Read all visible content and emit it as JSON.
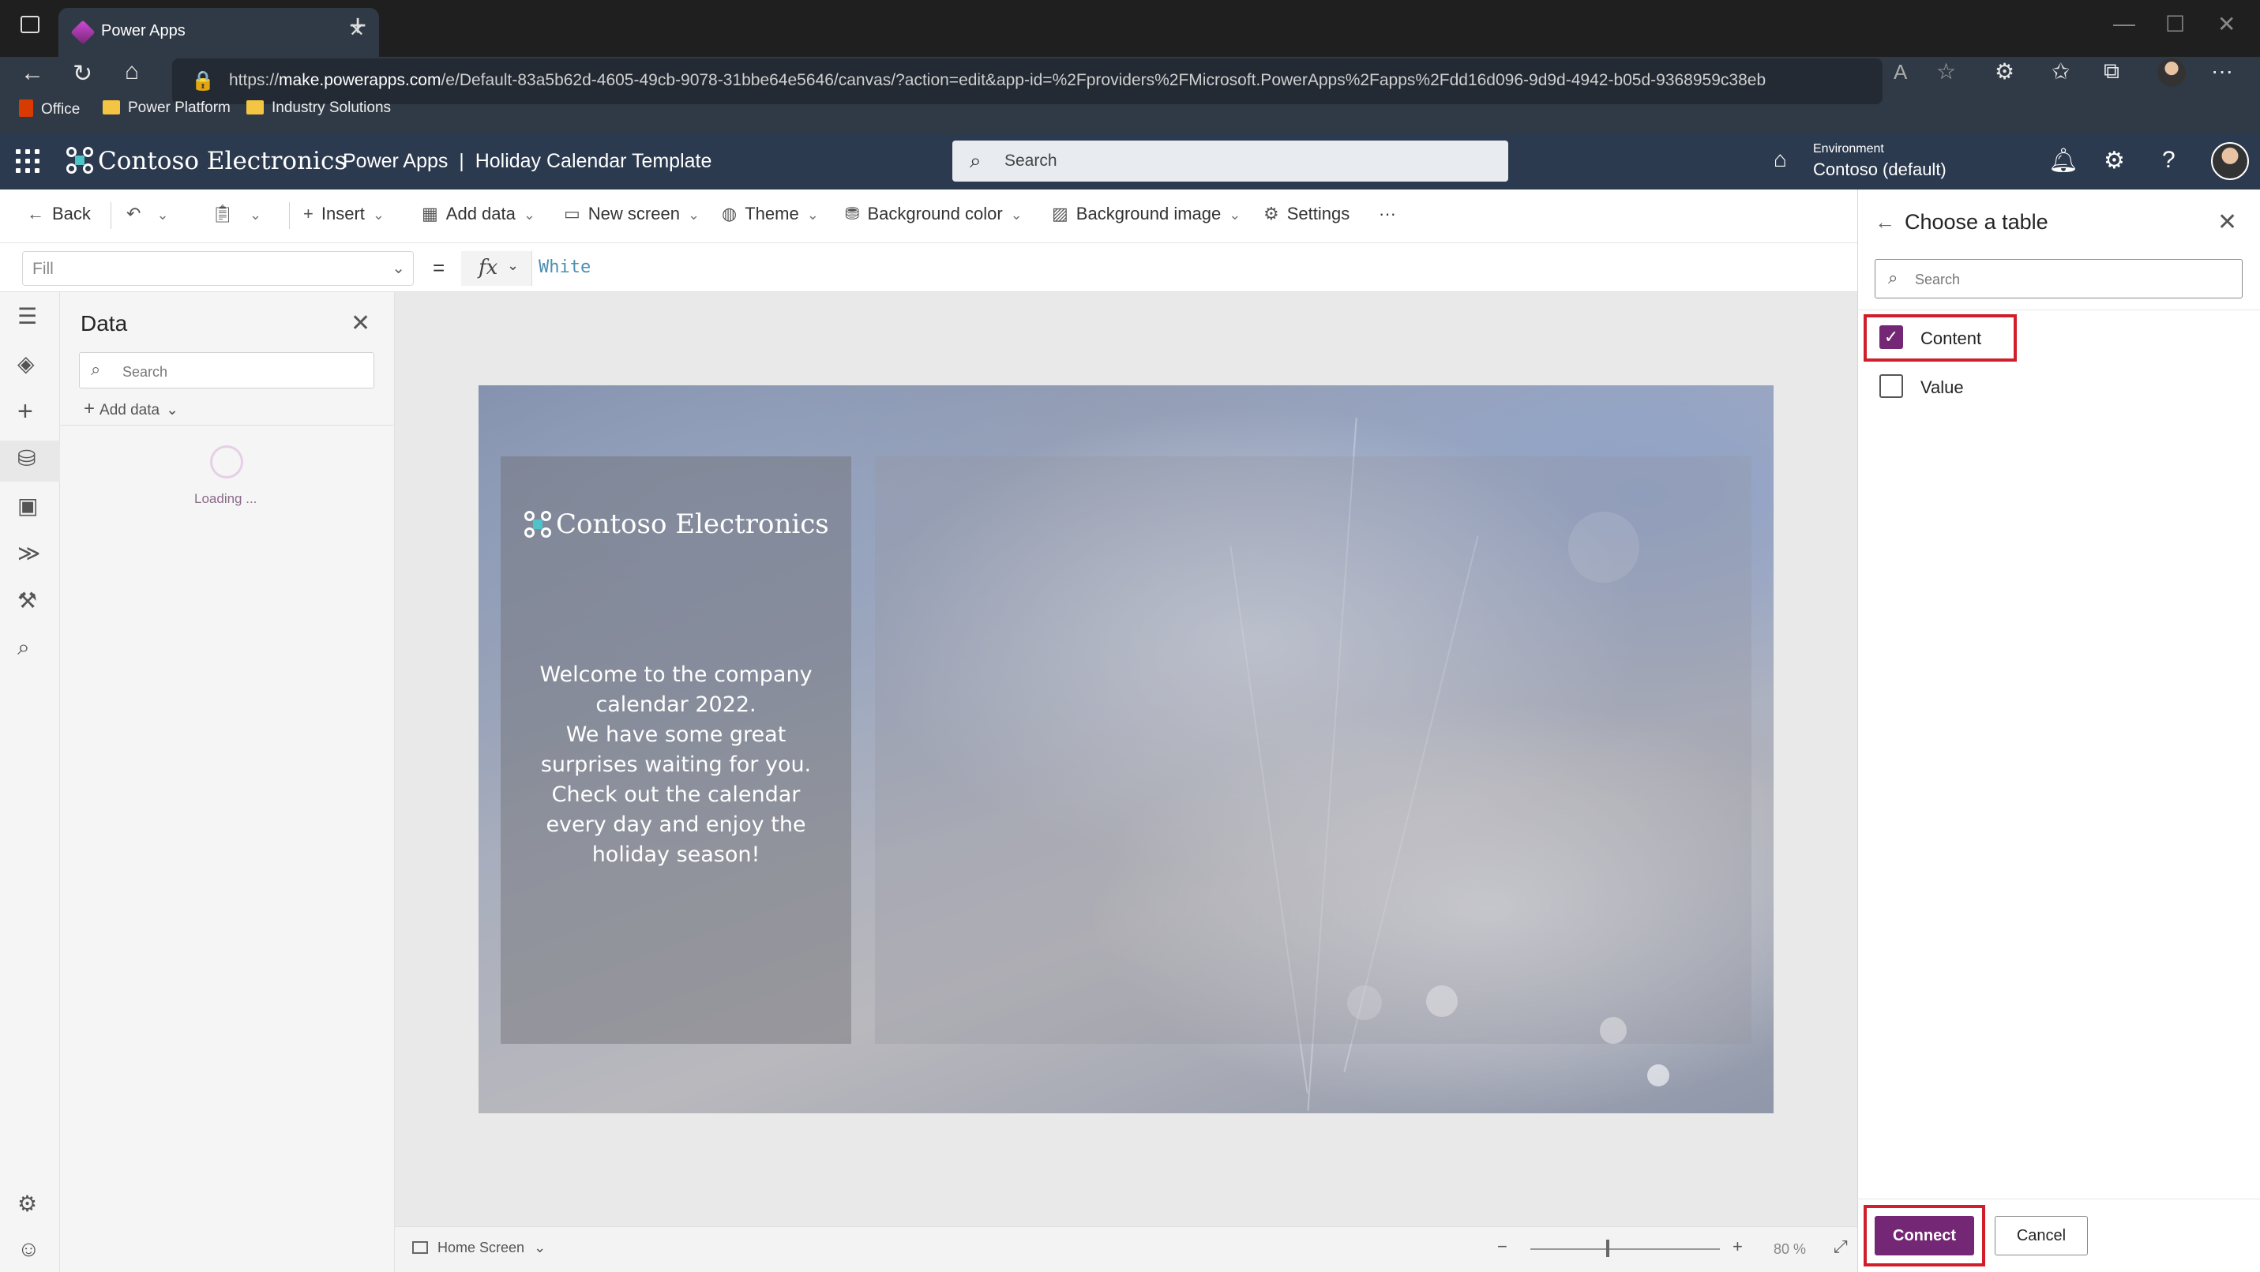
{
  "browser": {
    "tab_title": "Power Apps",
    "url_prefix": "https://",
    "url_host": "make.powerapps.com",
    "url_path": "/e/Default-83a5b62d-4605-49cb-9078-31bbe64e5646/canvas/?action=edit&app-id=%2Fproviders%2FMicrosoft.PowerApps%2Fapps%2Fdd16d096-9d9d-4942-b05d-9368959c38eb",
    "favorites": [
      "Office",
      "Power Platform",
      "Industry Solutions"
    ]
  },
  "app_header": {
    "brand": "Contoso Electronics",
    "app_title": "Power Apps  |  Holiday Calendar Template",
    "search_placeholder": "Search",
    "environment_label": "Environment",
    "environment_value": "Contoso (default)"
  },
  "commands": {
    "back": "Back",
    "insert": "Insert",
    "add_data": "Add data",
    "new_screen": "New screen",
    "theme": "Theme",
    "background_color": "Background color",
    "background_image": "Background image",
    "settings": "Settings",
    "more": "···"
  },
  "formula_bar": {
    "property": "Fill",
    "equals": "=",
    "fx": "fx",
    "formula": "White"
  },
  "data_pane": {
    "title": "Data",
    "search_placeholder": "Search",
    "add_data": "Add data",
    "loading": "Loading ..."
  },
  "canvas": {
    "logo_text": "Contoso Electronics",
    "paragraph1": "Welcome to the company calendar 2022.",
    "paragraph2": "We have some great surprises waiting for you.",
    "paragraph3": "Check out the calendar every day and enjoy the holiday season!"
  },
  "status_bar": {
    "screen_name": "Home Screen",
    "zoom_minus": "−",
    "zoom_plus": "+",
    "zoom_value": "80 %",
    "zoom_level": 0.8
  },
  "choose_table": {
    "title": "Choose a table",
    "search_placeholder": "Search",
    "options": [
      {
        "label": "Content",
        "checked": true
      },
      {
        "label": "Value",
        "checked": false
      }
    ],
    "connect_label": "Connect",
    "cancel_label": "Cancel"
  },
  "colors": {
    "accent": "#742774",
    "header_bg": "#2b3a4f",
    "highlight": "#d11e2a"
  }
}
